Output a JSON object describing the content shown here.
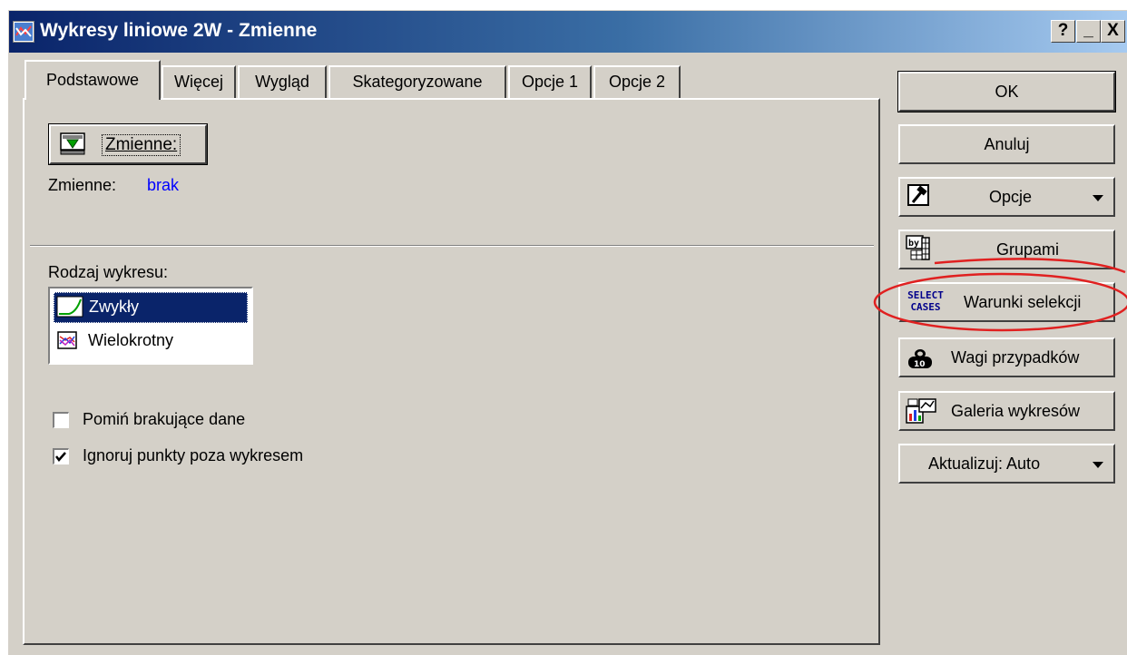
{
  "window": {
    "title": "Wykresy liniowe 2W - Zmienne",
    "help_label": "?",
    "minimize_label": "_",
    "close_label": "X"
  },
  "tabs": [
    "Podstawowe",
    "Więcej",
    "Wygląd",
    "Skategoryzowane",
    "Opcje 1",
    "Opcje 2"
  ],
  "active_tab": "Podstawowe",
  "variables": {
    "button_label": "Zmienne:",
    "label": "Zmienne:",
    "value": "brak"
  },
  "chart_type": {
    "label": "Rodzaj wykresu:",
    "options": [
      "Zwykły",
      "Wielokrotny"
    ],
    "selected": "Zwykły"
  },
  "checkboxes": [
    {
      "label": "Pomiń brakujące dane",
      "checked": false
    },
    {
      "label": "Ignoruj punkty poza wykresem",
      "checked": true
    }
  ],
  "right_buttons": {
    "ok": "OK",
    "cancel": "Anuluj",
    "options": "Opcje",
    "groups": "Grupami",
    "select_cases": "Warunki selekcji",
    "select_icon_line1": "SELECT",
    "select_icon_line2": "CASES",
    "weights": "Wagi przypadków",
    "gallery": "Galeria wykresów",
    "update": "Aktualizuj: Auto"
  },
  "colors": {
    "face": "#d4d0c8",
    "selection": "#0a246a",
    "link_value": "#0000ff",
    "annotation": "#e02020"
  }
}
